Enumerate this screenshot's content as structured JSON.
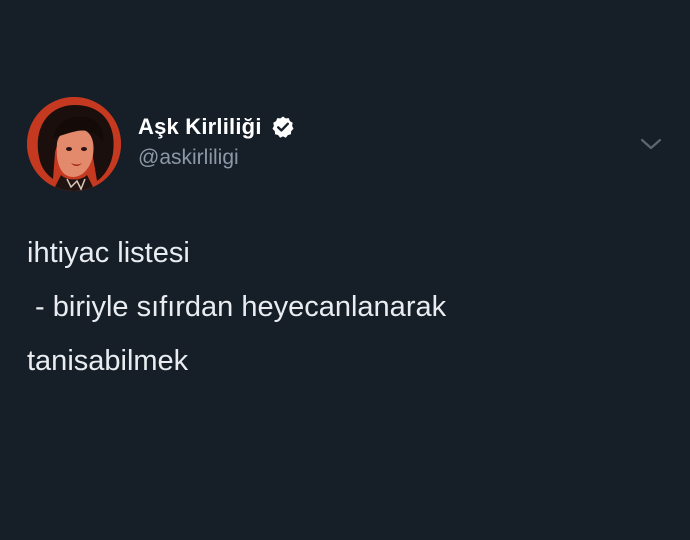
{
  "author": {
    "display_name": "Aşk Kirliliği",
    "handle": "@askirliligi",
    "verified": true
  },
  "tweet": {
    "lines": [
      "ihtiyac listesi",
      " - biriyle sıfırdan heyecanlanarak",
      "tanisabilmek"
    ]
  },
  "icons": {
    "verified": "verified-badge-icon",
    "menu": "chevron-down-icon"
  },
  "colors": {
    "background": "#161e28",
    "text": "#e9edf1",
    "secondary_text": "#8b98a5",
    "avatar_accent": "#c1381e"
  }
}
